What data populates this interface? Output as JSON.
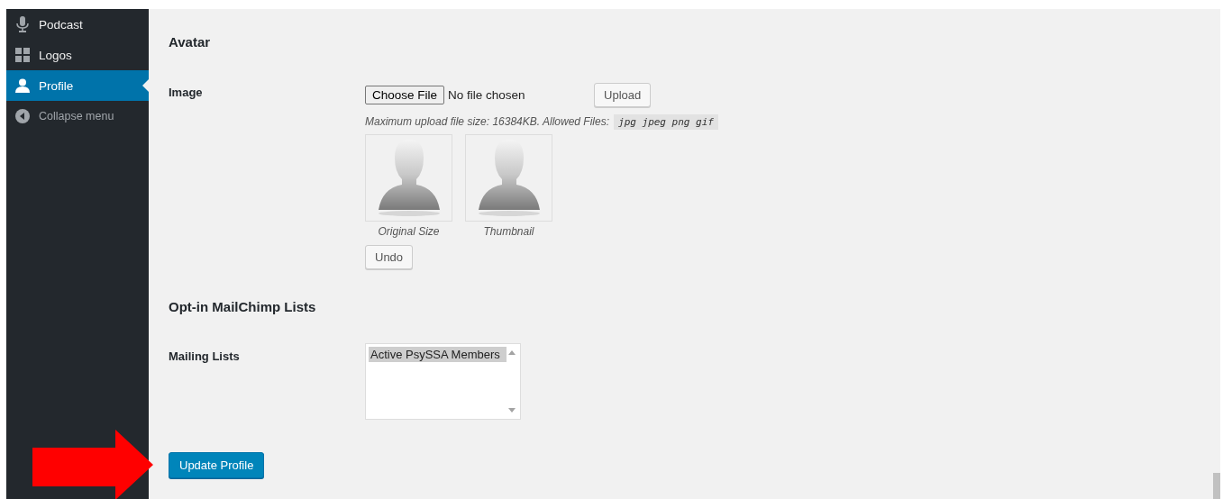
{
  "sidebar": {
    "items": [
      {
        "label": "Podcast",
        "kind": "link",
        "selected": false
      },
      {
        "label": "Logos",
        "kind": "link",
        "selected": false
      },
      {
        "label": "Profile",
        "kind": "link",
        "selected": true
      },
      {
        "label": "Collapse menu",
        "kind": "collapse",
        "selected": false
      }
    ]
  },
  "avatar_section": {
    "heading": "Avatar",
    "label": "Image",
    "file_button": "Choose File",
    "file_status": "No file chosen",
    "upload_button": "Upload",
    "hint": "Maximum upload file size: 16384KB. Allowed Files:",
    "allowed_types": "jpg jpeg png gif",
    "previews": [
      {
        "caption": "Original Size"
      },
      {
        "caption": "Thumbnail"
      }
    ],
    "undo_button": "Undo"
  },
  "mailchimp_section": {
    "heading": "Opt-in MailChimp Lists",
    "label": "Mailing Lists",
    "options": [
      {
        "label": "Active PsySSA Members",
        "selected": true
      }
    ]
  },
  "submit_button": "Update Profile"
}
